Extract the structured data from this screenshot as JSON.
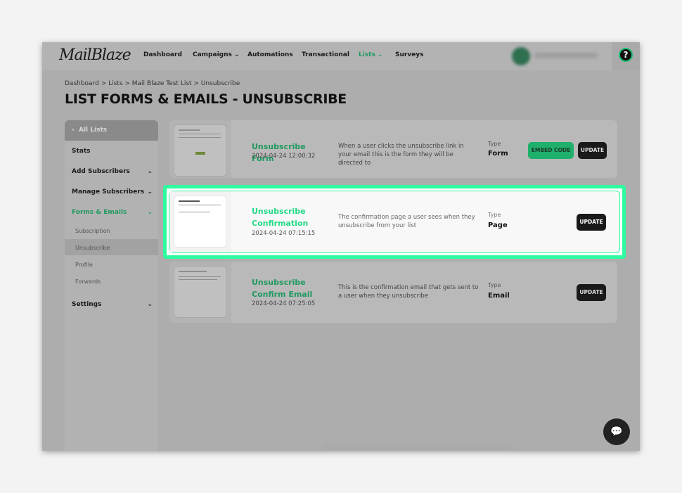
{
  "header": {
    "logo": "MailBlaze",
    "nav": [
      {
        "label": "Dashboard"
      },
      {
        "label": "Campaigns",
        "chevron": true
      },
      {
        "label": "Automations"
      },
      {
        "label": "Transactional"
      },
      {
        "label": "Lists",
        "chevron": true,
        "active": true
      },
      {
        "label": "Surveys"
      }
    ],
    "help_icon": "question-icon"
  },
  "breadcrumb": "Dashboard > Lists > Mail Blaze Test List > Unsubscribe",
  "page_title": "LIST FORMS & EMAILS - UNSUBSCRIBE",
  "sidebar": {
    "back": "All Lists",
    "items": [
      {
        "label": "Stats"
      },
      {
        "label": "Add Subscribers"
      },
      {
        "label": "Manage Subscribers"
      },
      {
        "label": "Forms & Emails",
        "active": true
      }
    ],
    "subitems": [
      {
        "label": "Subscription"
      },
      {
        "label": "Unsubscribe",
        "selected": true
      },
      {
        "label": "Profile"
      },
      {
        "label": "Forwards"
      }
    ],
    "settings": "Settings"
  },
  "items": [
    {
      "name": "Unsubscribe Form",
      "date": "2024-04-24 12:00:32",
      "desc": "When a user clicks the unsubscribe link in your email this is the form they will be directed to",
      "type_label": "Type",
      "type": "Form",
      "embed": "EMBED CODE",
      "update": "UPDATE"
    },
    {
      "name": "Unsubscribe Confirmation",
      "date": "2024-04-24 07:15:15",
      "desc": "The confirmation page a user sees when they unsubscribe from your list",
      "type_label": "Type",
      "type": "Page",
      "update": "UPDATE"
    },
    {
      "name": "Unsubscribe Confirm Email",
      "date": "2024-04-24 07:25:05",
      "desc": "This is the confirmation email that gets sent to a user when they unsubscribe",
      "type_label": "Type",
      "type": "Email",
      "update": "UPDATE"
    }
  ],
  "colors": {
    "accent": "#1f9a5f",
    "highlight": "#2dfc9f"
  }
}
